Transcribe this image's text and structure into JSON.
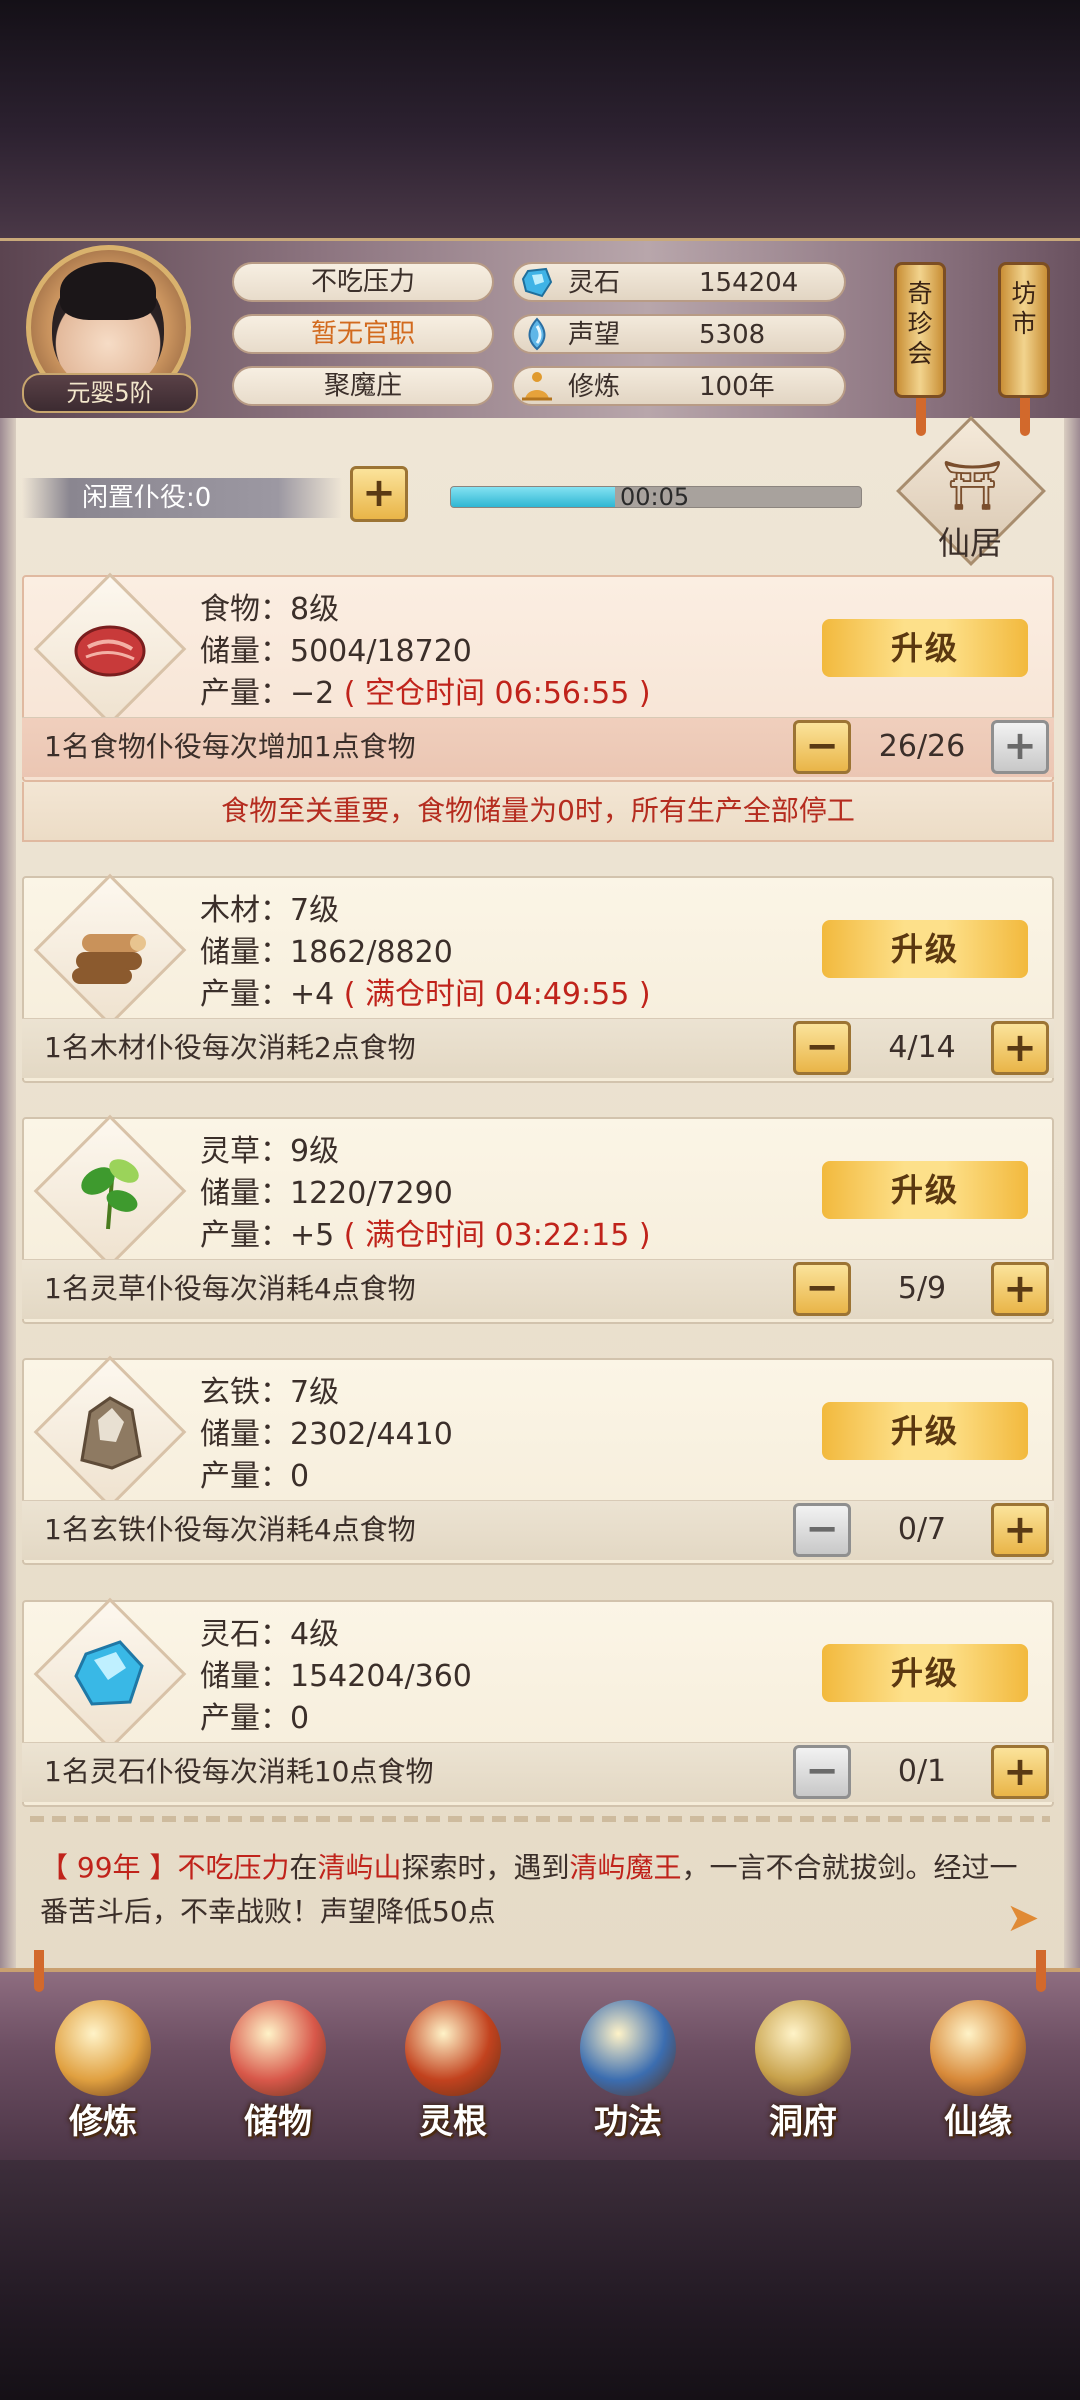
{
  "player": {
    "rank": "元婴5阶",
    "name": "不吃压力",
    "title": "暂无官职",
    "location": "聚魔庄"
  },
  "stats": [
    {
      "icon": "spirit-stone-icon",
      "label": "灵石",
      "value": "154204"
    },
    {
      "icon": "reputation-icon",
      "label": "声望",
      "value": "5308"
    },
    {
      "icon": "meditation-icon",
      "label": "修炼",
      "value": "100年"
    }
  ],
  "side_buttons": {
    "treasure": "奇珍会",
    "market": "坊市"
  },
  "idle": {
    "label": "闲置仆役:0",
    "timer": "00:05",
    "progress": 0.4
  },
  "residence": {
    "label": "仙居"
  },
  "resources": [
    {
      "name_line": "食物：8级",
      "storage_line": "储量：5004/18720",
      "output_prefix": "产量：−2",
      "output_note": "( 空仓时间 06:56:55 )",
      "worker_text": "1名食物仆役每次增加1点食物",
      "count": "26/26",
      "upgrade": "升级",
      "minus_enabled": true,
      "plus_enabled": false
    },
    {
      "name_line": "木材：7级",
      "storage_line": "储量：1862/8820",
      "output_prefix": "产量：+4",
      "output_note": "( 满仓时间 04:49:55 )",
      "worker_text": "1名木材仆役每次消耗2点食物",
      "count": "4/14",
      "upgrade": "升级",
      "minus_enabled": true,
      "plus_enabled": true
    },
    {
      "name_line": "灵草：9级",
      "storage_line": "储量：1220/7290",
      "output_prefix": "产量：+5",
      "output_note": "( 满仓时间 03:22:15 )",
      "worker_text": "1名灵草仆役每次消耗4点食物",
      "count": "5/9",
      "upgrade": "升级",
      "minus_enabled": true,
      "plus_enabled": true
    },
    {
      "name_line": "玄铁：7级",
      "storage_line": "储量：2302/4410",
      "output_prefix": "产量：0",
      "output_note": "",
      "worker_text": "1名玄铁仆役每次消耗4点食物",
      "count": "0/7",
      "upgrade": "升级",
      "minus_enabled": false,
      "plus_enabled": true
    },
    {
      "name_line": "灵石：4级",
      "storage_line": "储量：154204/360",
      "output_prefix": "产量：0",
      "output_note": "",
      "worker_text": "1名灵石仆役每次消耗10点食物",
      "count": "0/1",
      "upgrade": "升级",
      "minus_enabled": false,
      "plus_enabled": true
    }
  ],
  "food_warning": "食物至关重要，食物储量为0时，所有生产全部停工",
  "log": {
    "year": "【 99年 】",
    "actor": "不吃压力",
    "t1": "在",
    "place": "清屿山",
    "t2": "探索时，遇到",
    "enemy": "清屿魔王",
    "t3": "，一言不合就拔剑。经过一番苦斗后，不幸战败！声望降低50点"
  },
  "nav": [
    {
      "label": "修炼",
      "icon": "cultivation-icon",
      "color": "#e0a040"
    },
    {
      "label": "储物",
      "icon": "storage-bag-icon",
      "color": "#d8584a"
    },
    {
      "label": "灵根",
      "icon": "spirit-root-icon",
      "color": "#c2421e"
    },
    {
      "label": "功法",
      "icon": "manual-book-icon",
      "color": "#3b6db0"
    },
    {
      "label": "洞府",
      "icon": "cave-dwelling-icon",
      "color": "#c8a24c"
    },
    {
      "label": "仙缘",
      "icon": "fortune-gourd-icon",
      "color": "#d88a3a"
    }
  ],
  "colors": {
    "accent_red": "#c0231b",
    "gold_button": "#f2b93d",
    "progress": "#2fb6d3"
  }
}
